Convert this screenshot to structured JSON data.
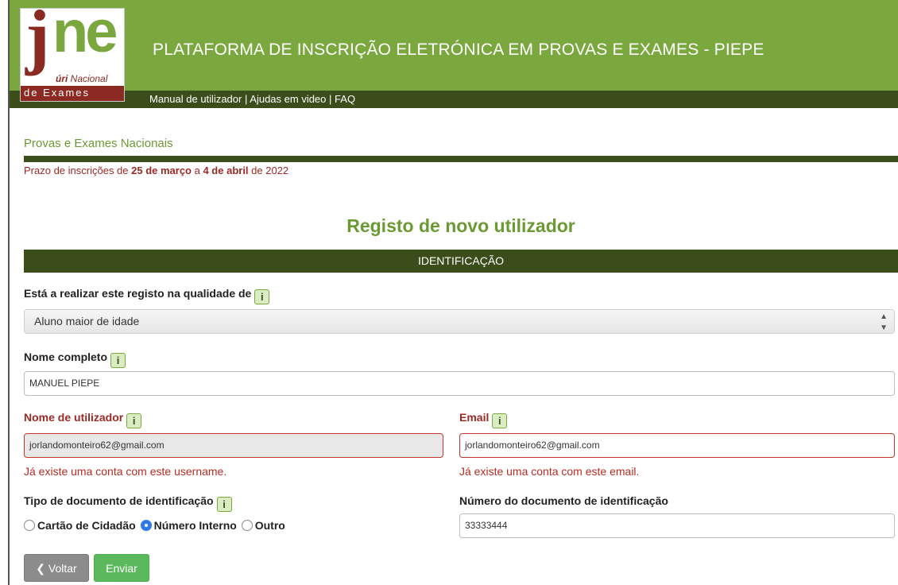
{
  "header": {
    "logo": {
      "big_text": "jne",
      "line1_bold": "úri",
      "line1_rest": " Nacional",
      "line2": "de Exames"
    },
    "title": "PLATAFORMA DE INSCRIÇÃO ELETRÓNICA EM PROVAS E EXAMES - PIEPE",
    "links": [
      "Manual de utilizador",
      "Ajudas em video",
      "FAQ"
    ],
    "separator": "|",
    "colors": {
      "green": "#7aa83f",
      "dark_green": "#3b4d1a",
      "brand_red": "#8b2a22"
    }
  },
  "section": {
    "title": "Provas e Exames Nacionais",
    "deadline": {
      "prefix": "Prazo de inscrições de ",
      "start": "25 de março",
      "middle": " a ",
      "end": "4 de abril",
      "suffix": " de 2022"
    }
  },
  "page_title": "Registo de novo utilizador",
  "band_title": "IDENTIFICAÇÃO",
  "info_icon_text": "i",
  "form": {
    "role": {
      "label": "Está a realizar este registo na qualidade de",
      "selected": "Aluno maior de idade"
    },
    "full_name": {
      "label": "Nome completo",
      "value": "MANUEL PIEPE"
    },
    "username": {
      "label": "Nome de utilizador",
      "value": "jorlandomonteiro62@gmail.com",
      "error": "Já existe uma conta com este username."
    },
    "email": {
      "label": "Email",
      "value": "jorlandomonteiro62@gmail.com",
      "error": "Já existe uma conta com este email."
    },
    "doc_type": {
      "label": "Tipo de documento de identificação",
      "options": [
        "Cartão de Cidadão",
        "Número Interno",
        "Outro"
      ],
      "selected": "Número Interno"
    },
    "doc_number": {
      "label": "Número do documento de identificação",
      "value": "33333444"
    }
  },
  "buttons": {
    "back": "Voltar",
    "back_icon": "chevron-left-icon",
    "send": "Enviar"
  },
  "colors": {
    "error": "#9b2a25",
    "success_button": "#5cb85c",
    "back_button": "#8c8c8c",
    "radio_selected": "#2f7be5"
  }
}
